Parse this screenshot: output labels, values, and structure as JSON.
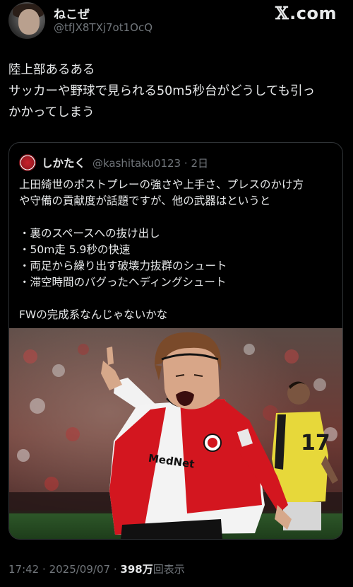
{
  "author": {
    "display_name": "ねこぜ",
    "handle": "@tfJX8TXj7ot1OcQ"
  },
  "brand": {
    "logo_mark": "𝕏",
    "logo_text": ".com"
  },
  "tweet": {
    "lines": [
      "陸上部あるある",
      "サッカーや野球で見られる50m5秒台がどうしても引っ",
      "かかってしまう"
    ]
  },
  "quote": {
    "author_name": "しかたく",
    "author_handle": "@kashitaku0123",
    "separator": "·",
    "age": "2日",
    "lines": [
      "上田綺世のポストプレーの強さや上手さ、プレスのかけ方",
      "や守備の貢献度が話題ですが、他の武器はというと",
      "",
      "・裏のスペースへの抜け出し",
      "・50m走 5.9秒の快速",
      "・両足から繰り出す破壊力抜群のシュート",
      "・滞空時間のバグったヘディングシュート",
      "",
      "FWの完成系なんじゃないかな"
    ],
    "image": {
      "shirt_sponsor": "MedNet",
      "right_player_number": "17"
    }
  },
  "footer": {
    "time": "17:42",
    "separator": "·",
    "date": "2025/09/07",
    "separator2": "·",
    "views_count": "398万",
    "views_label": "回表示"
  },
  "colors": {
    "background": "#000000",
    "text": "#e7e9ea",
    "secondary": "#71767b",
    "border": "#2f3336",
    "jersey_red": "#d3161f"
  }
}
